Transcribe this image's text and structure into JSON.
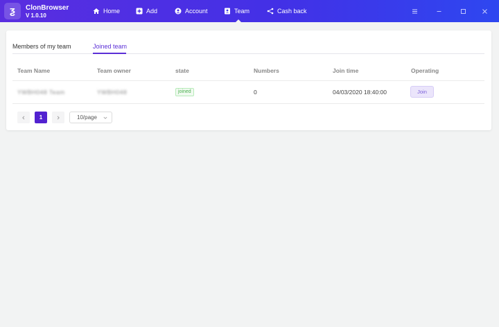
{
  "app": {
    "name": "ClonBrowser",
    "version": "V 1.0.10",
    "logo_glyph": "ƺ"
  },
  "nav": [
    {
      "label": "Home",
      "icon": "home-icon"
    },
    {
      "label": "Add",
      "icon": "plus-square-icon"
    },
    {
      "label": "Account",
      "icon": "user-circle-icon"
    },
    {
      "label": "Team",
      "icon": "team-icon",
      "active": true
    },
    {
      "label": "Cash back",
      "icon": "share-icon"
    }
  ],
  "window_controls": [
    "menu-icon",
    "minimize-icon",
    "maximize-icon",
    "close-icon"
  ],
  "tabs": [
    {
      "label": "Members of my team",
      "active": false
    },
    {
      "label": "Joined team",
      "active": true
    }
  ],
  "table": {
    "columns": [
      "Team Name",
      "Team owner",
      "state",
      "Numbers",
      "Join time",
      "Operating"
    ],
    "rows": [
      {
        "team_name": "YWBH048 Team",
        "team_owner": "YWBH048",
        "state": "joined",
        "numbers": "0",
        "join_time": "04/03/2020 18:40:00",
        "action": "Join"
      }
    ]
  },
  "pagination": {
    "current_page": "1",
    "page_size": "10/page"
  },
  "colors": {
    "accent": "#5b2fd6",
    "header_start": "#5a2ee0",
    "header_end": "#2e47f0",
    "state_green": "#4caf50"
  }
}
